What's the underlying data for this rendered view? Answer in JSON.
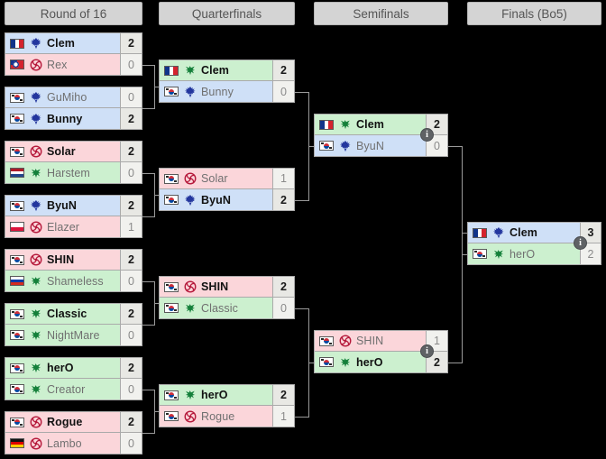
{
  "rounds": [
    {
      "label": "Round of 16"
    },
    {
      "label": "Quarterfinals"
    },
    {
      "label": "Semifinals"
    },
    {
      "label": "Finals (Bo5)"
    }
  ],
  "colors": {
    "terran": "#cfe0f7",
    "zerg": "#fbd6da",
    "protoss": "#ccf0cf",
    "header_bg": "#d4d4d4",
    "background": "#000000",
    "connector": "#9a9a9a"
  },
  "icons": {
    "info_badge": "i",
    "terran": "terran-icon",
    "zerg": "zerg-icon",
    "protoss": "protoss-icon"
  },
  "matches": {
    "r16": [
      {
        "top": {
          "name": "Clem",
          "score": "2",
          "race": "terran",
          "flag": "fr",
          "winner": true
        },
        "bottom": {
          "name": "Rex",
          "score": "0",
          "race": "zerg",
          "flag": "tw",
          "winner": false
        }
      },
      {
        "top": {
          "name": "GuMiho",
          "score": "0",
          "race": "terran",
          "flag": "kr",
          "winner": false
        },
        "bottom": {
          "name": "Bunny",
          "score": "2",
          "race": "terran",
          "flag": "kr",
          "winner": true
        }
      },
      {
        "top": {
          "name": "Solar",
          "score": "2",
          "race": "zerg",
          "flag": "kr",
          "winner": true
        },
        "bottom": {
          "name": "Harstem",
          "score": "0",
          "race": "protoss",
          "flag": "nl",
          "winner": false
        }
      },
      {
        "top": {
          "name": "ByuN",
          "score": "2",
          "race": "terran",
          "flag": "kr",
          "winner": true
        },
        "bottom": {
          "name": "Elazer",
          "score": "1",
          "race": "zerg",
          "flag": "pl",
          "winner": false
        }
      },
      {
        "top": {
          "name": "SHIN",
          "score": "2",
          "race": "zerg",
          "flag": "kr",
          "winner": true
        },
        "bottom": {
          "name": "Shameless",
          "score": "0",
          "race": "protoss",
          "flag": "ru",
          "winner": false
        }
      },
      {
        "top": {
          "name": "Classic",
          "score": "2",
          "race": "protoss",
          "flag": "kr",
          "winner": true
        },
        "bottom": {
          "name": "NightMare",
          "score": "0",
          "race": "protoss",
          "flag": "kr",
          "winner": false
        }
      },
      {
        "top": {
          "name": "herO",
          "score": "2",
          "race": "protoss",
          "flag": "kr",
          "winner": true
        },
        "bottom": {
          "name": "Creator",
          "score": "0",
          "race": "protoss",
          "flag": "kr",
          "winner": false
        }
      },
      {
        "top": {
          "name": "Rogue",
          "score": "2",
          "race": "zerg",
          "flag": "kr",
          "winner": true
        },
        "bottom": {
          "name": "Lambo",
          "score": "0",
          "race": "zerg",
          "flag": "de",
          "winner": false
        }
      }
    ],
    "qf": [
      {
        "top": {
          "name": "Clem",
          "score": "2",
          "race": "protoss",
          "flag": "fr",
          "winner": true
        },
        "bottom": {
          "name": "Bunny",
          "score": "0",
          "race": "terran",
          "flag": "kr",
          "winner": false
        }
      },
      {
        "top": {
          "name": "Solar",
          "score": "1",
          "race": "zerg",
          "flag": "kr",
          "winner": false
        },
        "bottom": {
          "name": "ByuN",
          "score": "2",
          "race": "terran",
          "flag": "kr",
          "winner": true
        }
      },
      {
        "top": {
          "name": "SHIN",
          "score": "2",
          "race": "zerg",
          "flag": "kr",
          "winner": true
        },
        "bottom": {
          "name": "Classic",
          "score": "0",
          "race": "protoss",
          "flag": "kr",
          "winner": false
        }
      },
      {
        "top": {
          "name": "herO",
          "score": "2",
          "race": "protoss",
          "flag": "kr",
          "winner": true
        },
        "bottom": {
          "name": "Rogue",
          "score": "1",
          "race": "zerg",
          "flag": "kr",
          "winner": false
        }
      }
    ],
    "sf": [
      {
        "top": {
          "name": "Clem",
          "score": "2",
          "race": "protoss",
          "flag": "fr",
          "winner": true
        },
        "bottom": {
          "name": "ByuN",
          "score": "0",
          "race": "terran",
          "flag": "kr",
          "winner": false
        }
      },
      {
        "top": {
          "name": "SHIN",
          "score": "1",
          "race": "zerg",
          "flag": "kr",
          "winner": false
        },
        "bottom": {
          "name": "herO",
          "score": "2",
          "race": "protoss",
          "flag": "kr",
          "winner": true
        }
      }
    ],
    "final": [
      {
        "top": {
          "name": "Clem",
          "score": "3",
          "race": "terran",
          "flag": "fr",
          "winner": true
        },
        "bottom": {
          "name": "herO",
          "score": "2",
          "race": "protoss",
          "flag": "kr",
          "winner": false
        }
      }
    ]
  }
}
